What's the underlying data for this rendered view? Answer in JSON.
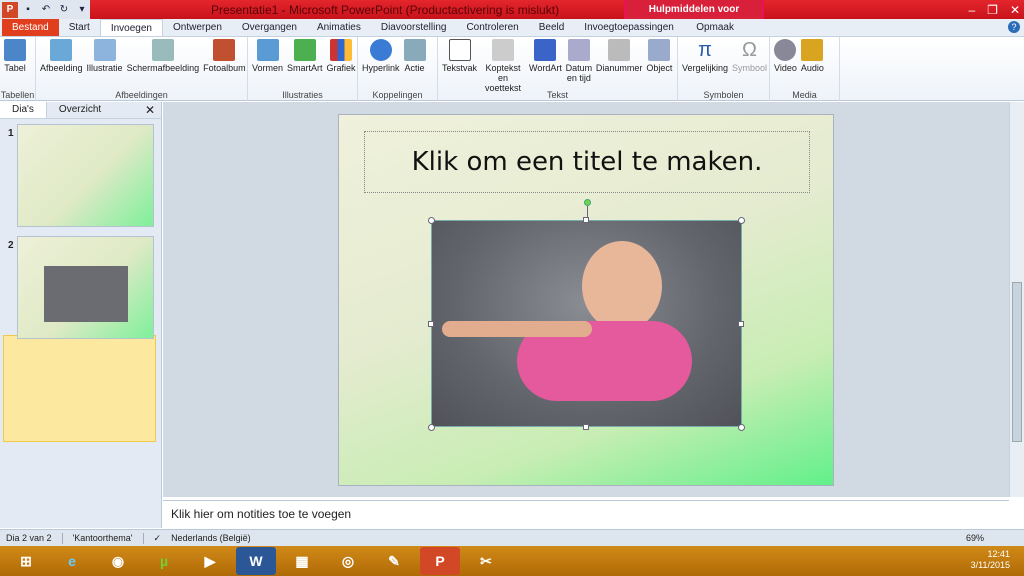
{
  "window": {
    "title": "Presentatie1  -  Microsoft PowerPoint (Productactivering is mislukt)",
    "context_tools": "Hulpmiddelen voor afbeeldingen"
  },
  "tabs": [
    "Bestand",
    "Start",
    "Invoegen",
    "Ontwerpen",
    "Overgangen",
    "Animaties",
    "Diavoorstelling",
    "Controleren",
    "Beeld",
    "Invoegtoepassingen"
  ],
  "ctx_tab": "Opmaak",
  "ribbon": {
    "groups": [
      {
        "name": "Tabellen",
        "items": [
          "Tabel"
        ]
      },
      {
        "name": "Afbeeldingen",
        "items": [
          "Afbeelding",
          "Illustratie",
          "Schermafbeelding",
          "Fotoalbum"
        ]
      },
      {
        "name": "Illustraties",
        "items": [
          "Vormen",
          "SmartArt",
          "Grafiek"
        ]
      },
      {
        "name": "Koppelingen",
        "items": [
          "Hyperlink",
          "Actie"
        ]
      },
      {
        "name": "Tekst",
        "items": [
          "Tekstvak",
          "Koptekst en voettekst",
          "WordArt",
          "Datum en tijd",
          "Dianummer",
          "Object"
        ]
      },
      {
        "name": "Symbolen",
        "items": [
          "Vergelijking",
          "Symbool"
        ]
      },
      {
        "name": "Media",
        "items": [
          "Video",
          "Audio"
        ]
      }
    ]
  },
  "panel": {
    "tab1": "Dia's",
    "tab2": "Overzicht",
    "slide1": "1",
    "slide2": "2"
  },
  "slide": {
    "title": "Klik om een titel te maken."
  },
  "notes": "Klik hier om notities toe te voegen",
  "status": {
    "slide": "Dia 2 van 2",
    "theme": "'Kantoorthema'",
    "lang": "Nederlands (België)",
    "zoom": "69%"
  },
  "clock": {
    "time": "12:41",
    "date": "3/11/2015"
  }
}
